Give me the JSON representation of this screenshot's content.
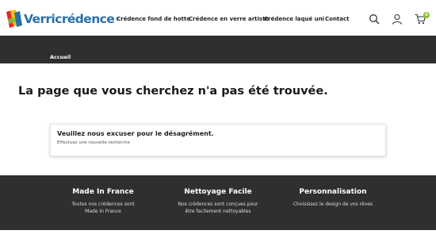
{
  "header": {
    "logo_text": "Verricrédence",
    "logo_reg": "®",
    "nav": [
      {
        "label": "Crédence fond de hotte"
      },
      {
        "label": "Crédence en verre artiste"
      },
      {
        "label": "Crédence laqué uni"
      },
      {
        "label": "Contact"
      }
    ],
    "icons": {
      "search": "search-icon",
      "account": "user-icon",
      "cart": "cart-icon"
    },
    "cart_count": "0"
  },
  "breadcrumb": {
    "home": "Accueil"
  },
  "main": {
    "title": "La page que vous cherchez n'a pas été trouvée.",
    "notice_title": "Veuillez nous excuser pour le désagrément.",
    "notice_sub": "Effectuez une nouvelle recherche"
  },
  "footer": {
    "columns": [
      {
        "title": "Made In France",
        "line1": "Toutes nos crédences sont",
        "line2": "Made In France"
      },
      {
        "title": "Nettoyage Facile",
        "line1": "Nos crédences sont conçues pour",
        "line2": "être facilement nettoyables"
      },
      {
        "title": "Personnalisation",
        "line1": "Choisissez le design de vos rêves",
        "line2": ""
      }
    ]
  },
  "colors": {
    "dark_band": "#2e2f31",
    "brand_blue": "#2a6fa8",
    "badge_green": "#8bbf2f"
  }
}
